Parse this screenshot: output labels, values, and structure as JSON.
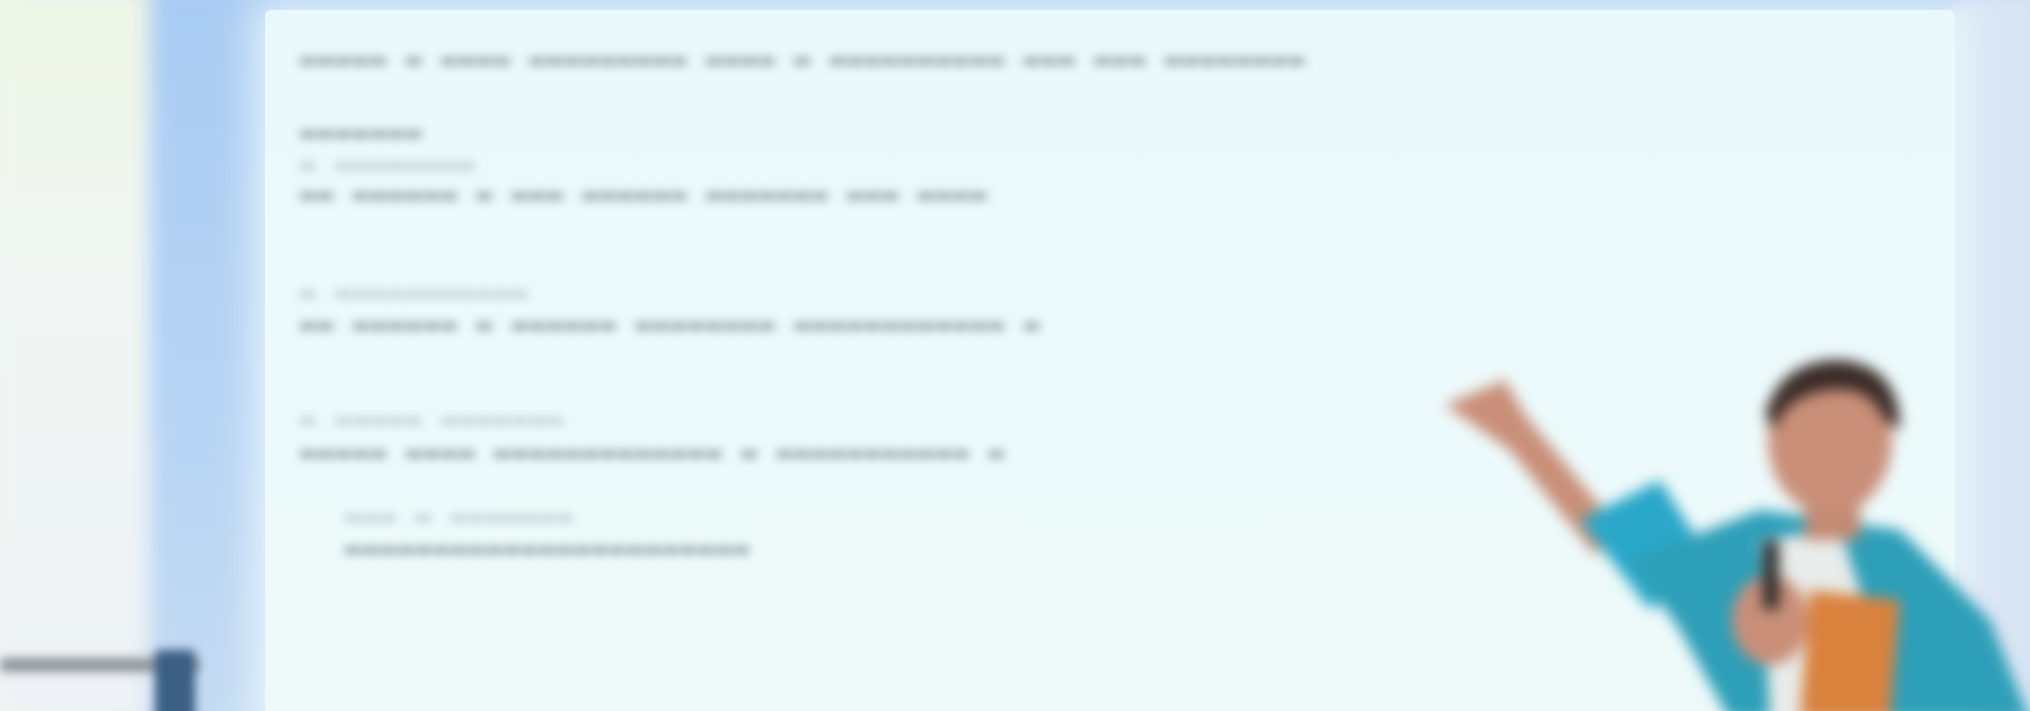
{
  "photo": {
    "description_tags": [
      "blurred-slide",
      "presenter",
      "projector-screen"
    ],
    "colors": {
      "screen_frame": "#b0cff3",
      "slide_background": "#ebf9fb",
      "slide_text": "#4a5a63",
      "speaker_shirt": "#2aa7c9",
      "speaker_skin": "#c98f78",
      "speaker_hair": "#3a2c28"
    }
  }
}
